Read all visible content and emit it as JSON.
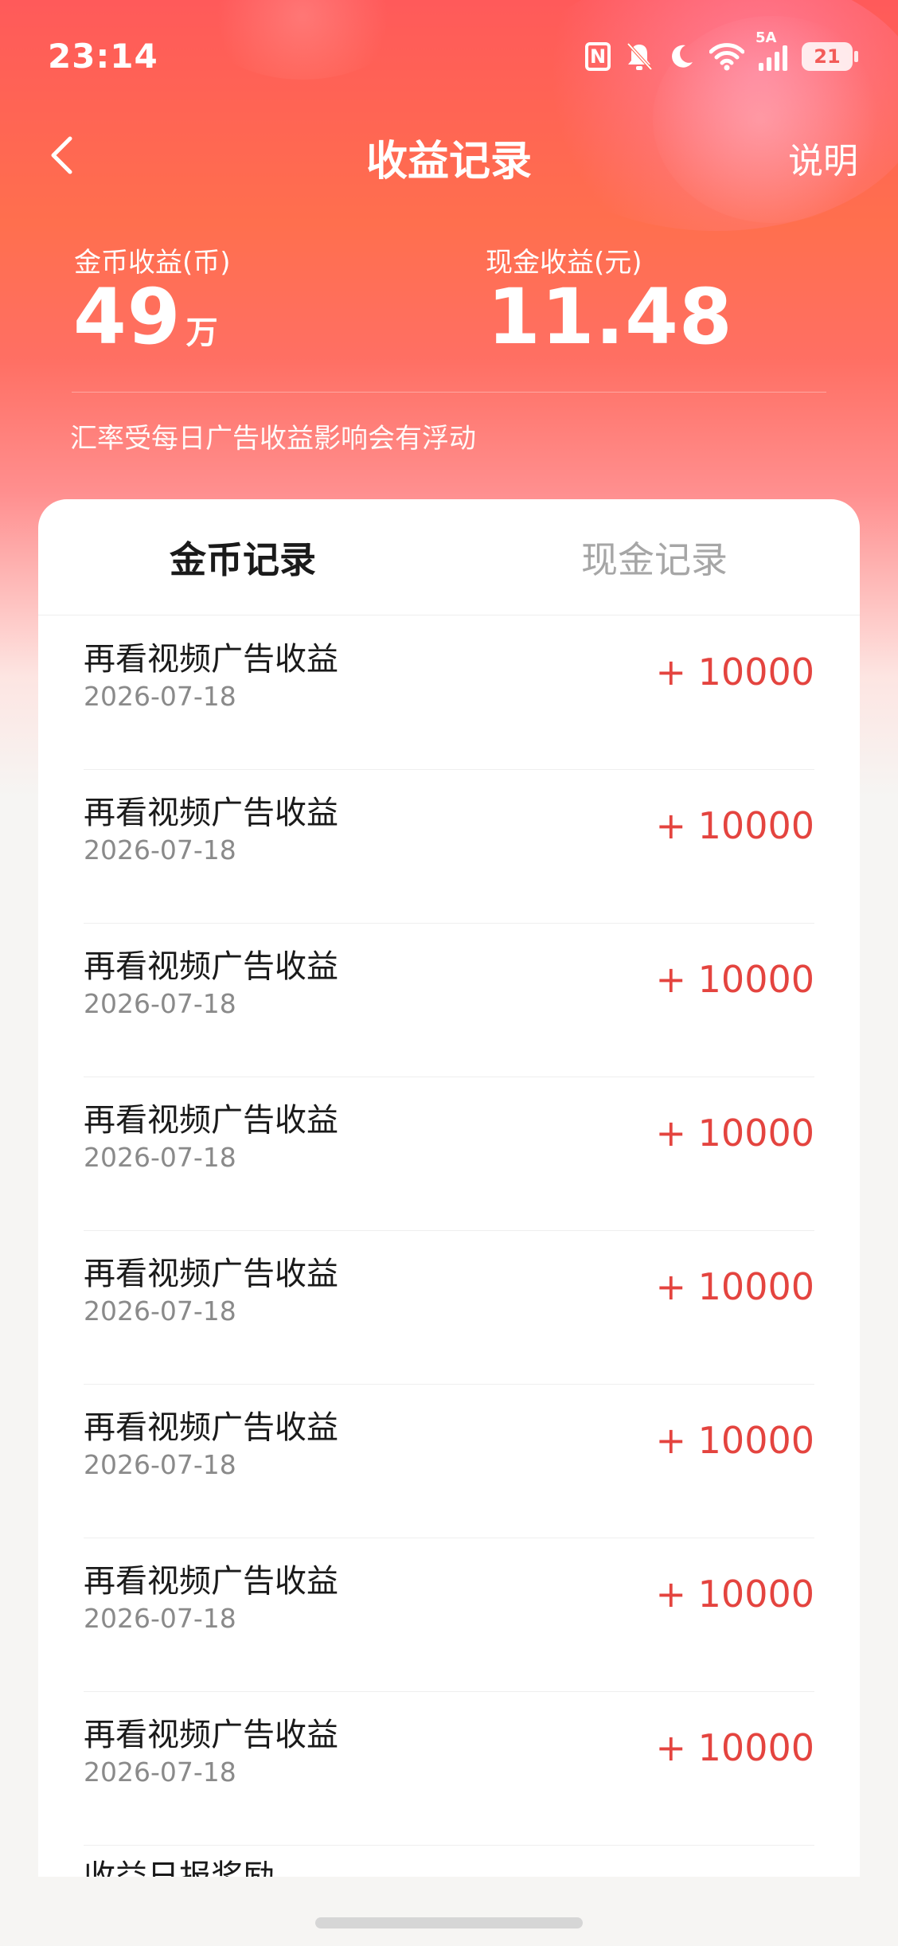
{
  "status_bar": {
    "time": "23:14",
    "network": "5A",
    "battery": "21",
    "icons": [
      "nfc-icon",
      "mute-bell-icon",
      "moon-icon",
      "wifi-icon",
      "signal-icon",
      "battery-icon"
    ]
  },
  "header": {
    "title": "收益记录",
    "help_label": "说明",
    "back_icon": "chevron-left-icon"
  },
  "summary": {
    "coins": {
      "label": "金币收益(币)",
      "value": "49",
      "unit": "万"
    },
    "cash": {
      "label": "现金收益(元)",
      "value": "11.48"
    },
    "note": "汇率受每日广告收益影响会有浮动"
  },
  "tabs": [
    {
      "label": "金币记录",
      "active": true
    },
    {
      "label": "现金记录",
      "active": false
    }
  ],
  "records": [
    {
      "title": "再看视频广告收益",
      "date": "2026-07-18",
      "amount": "+ 10000"
    },
    {
      "title": "再看视频广告收益",
      "date": "2026-07-18",
      "amount": "+ 10000"
    },
    {
      "title": "再看视频广告收益",
      "date": "2026-07-18",
      "amount": "+ 10000"
    },
    {
      "title": "再看视频广告收益",
      "date": "2026-07-18",
      "amount": "+ 10000"
    },
    {
      "title": "再看视频广告收益",
      "date": "2026-07-18",
      "amount": "+ 10000"
    },
    {
      "title": "再看视频广告收益",
      "date": "2026-07-18",
      "amount": "+ 10000"
    },
    {
      "title": "再看视频广告收益",
      "date": "2026-07-18",
      "amount": "+ 10000"
    },
    {
      "title": "再看视频广告收益",
      "date": "2026-07-18",
      "amount": "+ 10000"
    }
  ],
  "partial_record_title": "收益日报奖励",
  "colors": {
    "accent": "#e4443f",
    "header_gradient_top": "#ff5a5a",
    "header_gradient_mid": "#ff6f4e"
  }
}
